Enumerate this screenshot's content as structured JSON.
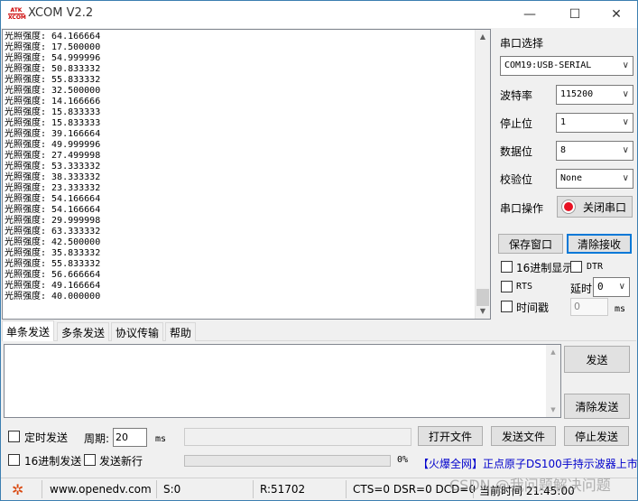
{
  "window": {
    "title": "XCOM V2.2",
    "logo_text_top": "ATK",
    "logo_text_bottom": "XCOM",
    "minimize": "—",
    "maximize": "☐",
    "close": "✕"
  },
  "receive": {
    "label": "光照强度: ",
    "values": [
      "64.166664",
      "17.500000",
      "54.999996",
      "50.833332",
      "55.833332",
      "32.500000",
      "14.166666",
      "15.833333",
      "15.833333",
      "39.166664",
      "49.999996",
      "27.499998",
      "53.333332",
      "38.333332",
      "23.333332",
      "54.166664",
      "54.166664",
      "29.999998",
      "63.333332",
      "42.500000",
      "35.833332",
      "55.833332",
      "56.666664",
      "49.166664",
      "40.000000"
    ]
  },
  "settings": {
    "port_select_label": "串口选择",
    "port_value": "COM19:USB-SERIAL",
    "baud_label": "波特率",
    "baud_value": "115200",
    "stopbits_label": "停止位",
    "stopbits_value": "1",
    "databits_label": "数据位",
    "databits_value": "8",
    "parity_label": "校验位",
    "parity_value": "None",
    "port_op_label": "串口操作",
    "port_op_button": "关闭串口",
    "save_window_button": "保存窗口",
    "clear_receive_button": "清除接收",
    "hex_display_label": "16进制显示",
    "dtr_label": "DTR",
    "rts_label": "RTS",
    "timeout_label": "延时",
    "timeout_value": "0",
    "timestamp_label": "时间戳",
    "timestamp_value": "0",
    "ms_label": "ms"
  },
  "tabs": [
    "单条发送",
    "多条发送",
    "协议传输",
    "帮助"
  ],
  "send": {
    "send_button": "发送",
    "clear_send_button": "清除发送",
    "timed_send_label": "定时发送",
    "period_label": "周期:",
    "period_value": "20",
    "ms_label": "ms",
    "open_file_button": "打开文件",
    "send_file_button": "发送文件",
    "stop_send_button": "停止发送",
    "hex_send_label": "16进制发送",
    "send_newline_label": "发送新行",
    "progress_percent_text": "0%",
    "progress_value": 0,
    "promo_text_bracket": "【火爆全网】",
    "promo_text": "正点原子DS100手持示波器上市"
  },
  "status": {
    "url": "www.openedv.com",
    "sent": "S:0",
    "received": "R:51702",
    "lines": "CTS=0 DSR=0 DCD=0",
    "time": "当前时间 21:45:00",
    "watermark": "CSDN @我问题解决问题"
  },
  "colors": {
    "accent": "#0078d7",
    "link": "#0000cc",
    "close_port_dot": "#e81123",
    "gear": "#d9480f"
  }
}
